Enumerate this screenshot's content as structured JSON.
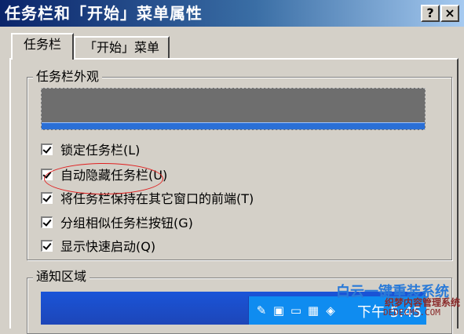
{
  "window": {
    "title": "任务栏和「开始」菜单属性",
    "help_label": "?",
    "close_label": "×"
  },
  "tabs": [
    {
      "label": "任务栏",
      "active": true
    },
    {
      "label": "「开始」菜单",
      "active": false
    }
  ],
  "appearance_group": {
    "legend": "任务栏外观",
    "options": [
      {
        "label": "锁定任务栏(L)",
        "checked": true
      },
      {
        "label": "自动隐藏任务栏(U)",
        "checked": true
      },
      {
        "label": "将任务栏保持在其它窗口的前端(T)",
        "checked": true
      },
      {
        "label": "分组相似任务栏按钮(G)",
        "checked": true
      },
      {
        "label": "显示快速启动(Q)",
        "checked": true
      }
    ]
  },
  "notify_group": {
    "legend": "通知区域",
    "tray_time": "下午 5:45"
  },
  "watermark": {
    "line1": "白云一键重装系统",
    "line2": "织梦内容管理系统",
    "line3": "DEDECMS.COM"
  },
  "colors": {
    "title_gradient_start": "#0a246a",
    "title_gradient_end": "#a6caf0",
    "dialog_bg": "#d4d0c8",
    "taskbar_blue": "#2a6fd6",
    "annotation_red": "#e02020"
  }
}
